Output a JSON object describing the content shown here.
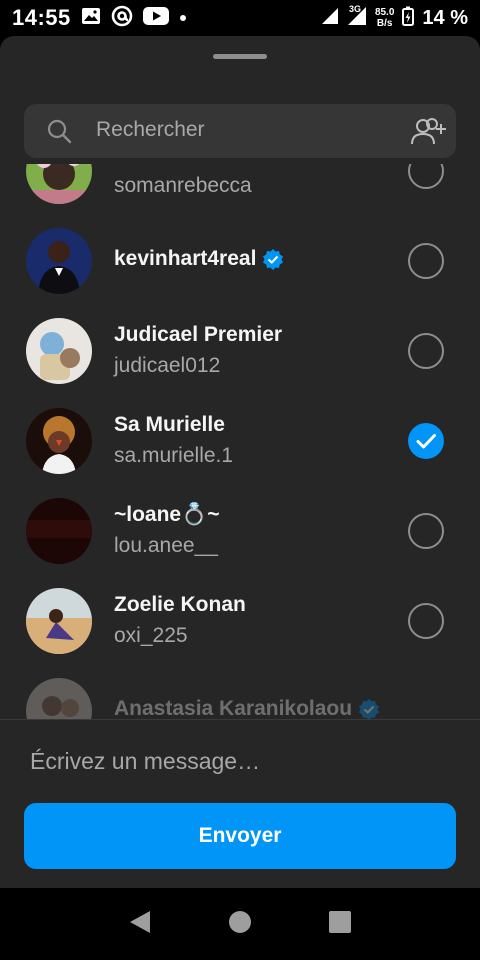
{
  "status_bar": {
    "time": "14:55",
    "network_type": "3G",
    "speed_value": "85.0",
    "speed_unit": "B/s",
    "battery": "14 %"
  },
  "search": {
    "placeholder": "Rechercher"
  },
  "contacts": [
    {
      "display_name": "",
      "username": "somanrebecca",
      "verified": false,
      "selected": false
    },
    {
      "display_name": "kevinhart4real",
      "username": "",
      "verified": true,
      "selected": false
    },
    {
      "display_name": "Judicael Premier",
      "username": "judicael012",
      "verified": false,
      "selected": false
    },
    {
      "display_name": "Sa Murielle",
      "username": "sa.murielle.1",
      "verified": false,
      "selected": true
    },
    {
      "display_name": "~loane💍~",
      "username": "lou.anee__",
      "verified": false,
      "selected": false
    },
    {
      "display_name": "Zoelie Konan",
      "username": "oxi_225",
      "verified": false,
      "selected": false
    },
    {
      "display_name": "Anastasia Karanikolaou",
      "username": "",
      "verified": true,
      "selected": false
    }
  ],
  "composer": {
    "placeholder": "Écrivez un message…"
  },
  "send_button": {
    "label": "Envoyer"
  },
  "colors": {
    "accent": "#0095f6",
    "sheet_bg": "#262626",
    "secondary_text": "#a8a8a8"
  }
}
